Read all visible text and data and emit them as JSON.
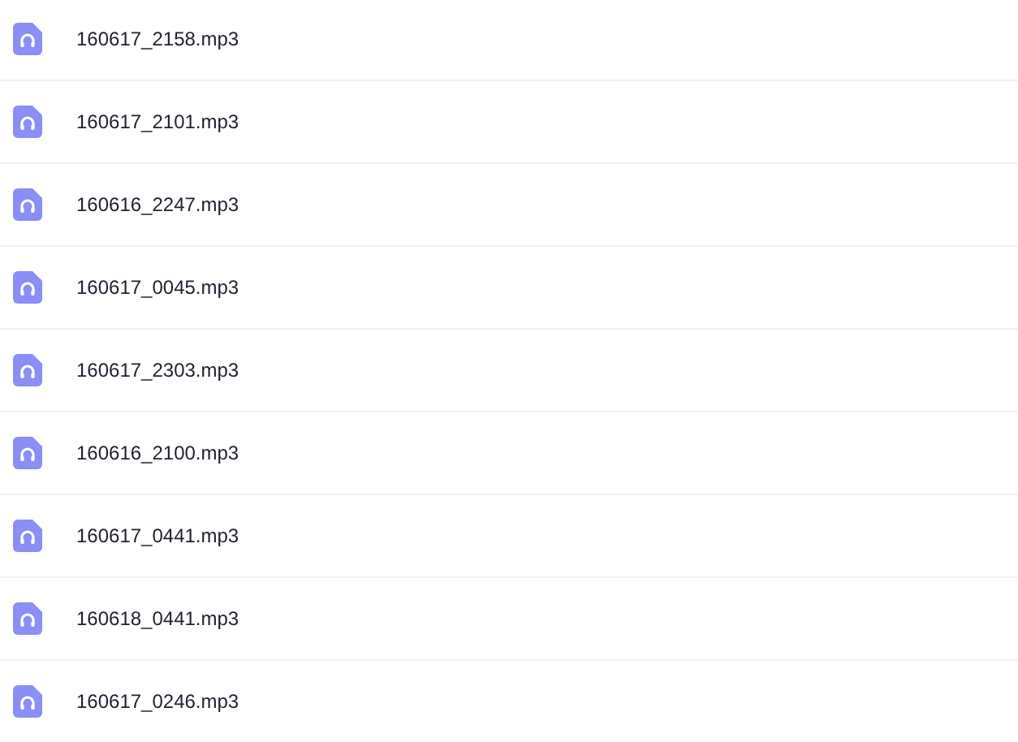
{
  "files": [
    {
      "name": "160617_2158.mp3"
    },
    {
      "name": "160617_2101.mp3"
    },
    {
      "name": "160616_2247.mp3"
    },
    {
      "name": "160617_0045.mp3"
    },
    {
      "name": "160617_2303.mp3"
    },
    {
      "name": "160616_2100.mp3"
    },
    {
      "name": "160617_0441.mp3"
    },
    {
      "name": "160618_0441.mp3"
    },
    {
      "name": "160617_0246.mp3"
    }
  ]
}
